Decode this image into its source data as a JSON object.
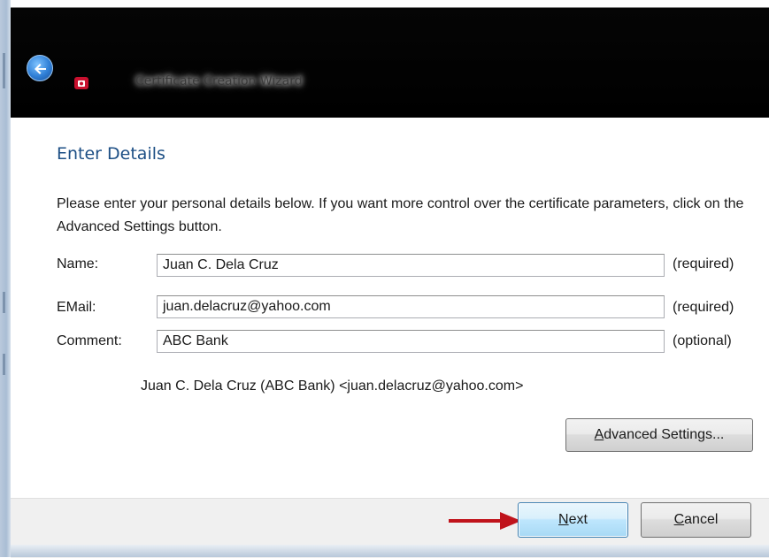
{
  "window": {
    "title": "Certificate Creation Wizard",
    "back_icon": "back-arrow-icon",
    "app_icon": "certificate-app-icon"
  },
  "page": {
    "heading": "Enter Details",
    "description": "Please enter your personal details below. If you want more control over the certificate parameters, click on the Advanced Settings button."
  },
  "form": {
    "fields": [
      {
        "label": "Name:",
        "value": "Juan C. Dela Cruz",
        "hint": "(required)"
      },
      {
        "label": "EMail:",
        "value": "juan.delacruz@yahoo.com",
        "hint": "(required)"
      },
      {
        "label": "Comment:",
        "value": "ABC Bank",
        "hint": "(optional)"
      }
    ],
    "summary": "Juan C. Dela Cruz (ABC Bank) <juan.delacruz@yahoo.com>"
  },
  "buttons": {
    "advanced_accel": "A",
    "advanced_rest": "dvanced Settings...",
    "next_accel": "N",
    "next_rest": "ext",
    "cancel_accel": "C",
    "cancel_rest": "ancel"
  },
  "colors": {
    "heading": "#1d4f85",
    "arrow": "#c0131b",
    "titlebar": "#000000"
  }
}
